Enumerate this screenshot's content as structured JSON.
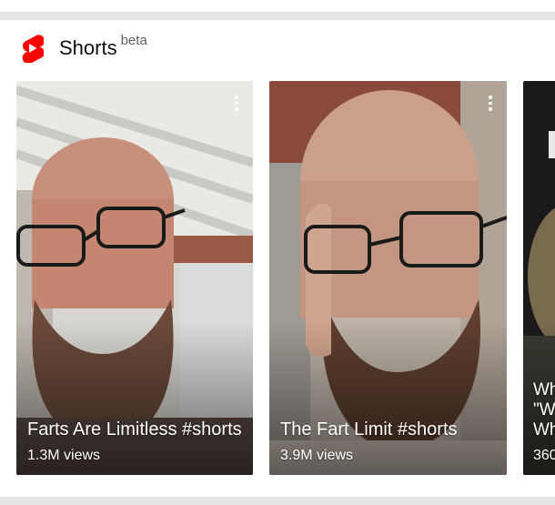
{
  "shelf": {
    "title": "Shorts",
    "badge": "beta",
    "icon": "youtube-shorts-icon",
    "brand_color": "#ff0000"
  },
  "videos": [
    {
      "title": "Farts Are Limitless #shorts",
      "views": "1.3M views"
    },
    {
      "title": "The Fart Limit #shorts",
      "views": "3.9M views"
    },
    {
      "title": "Wh\n\"W\nWh",
      "views": "360"
    }
  ]
}
